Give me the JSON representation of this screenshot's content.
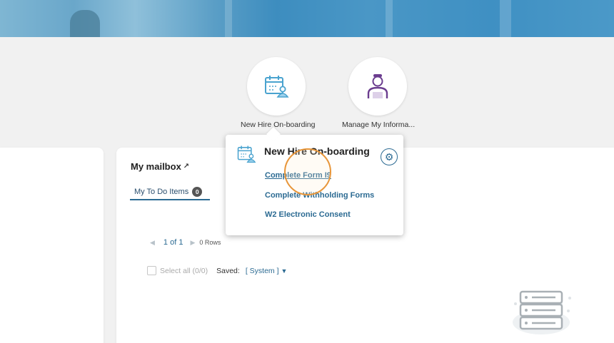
{
  "quick_tiles": [
    {
      "label": "New Hire On-boarding",
      "icon": "calendar-person-icon"
    },
    {
      "label": "Manage My Informa...",
      "icon": "person-icon"
    }
  ],
  "mailbox": {
    "title": "My mailbox",
    "title_icon": "external-arrow-icon",
    "tab_label": "My To Do Items",
    "tab_count": "0",
    "pager_text": "1 of 1",
    "rows_text": "0 Rows",
    "select_all_label": "Select all (0/0)",
    "saved_label": "Saved:",
    "saved_value": "[ System ]"
  },
  "popup": {
    "title": "New Hire On-boarding",
    "links": [
      "Complete Form I9",
      "Complete Withholding Forms",
      "W2 Electronic Consent"
    ]
  },
  "colors": {
    "accent": "#2b6a92",
    "highlight_ring": "#e8963a",
    "person_purple": "#6b3d8f",
    "calendar_blue": "#4aa3cf"
  }
}
